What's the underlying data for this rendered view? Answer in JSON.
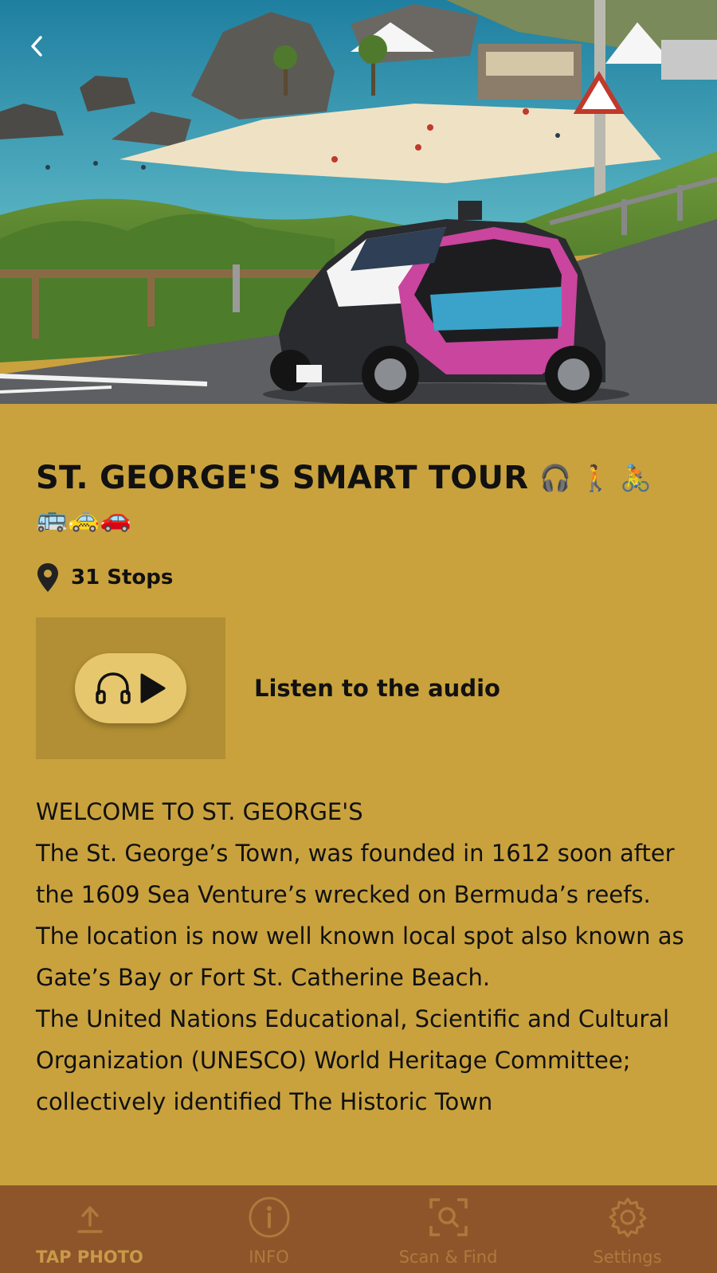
{
  "hero": {
    "back_icon": "chevron-left-icon"
  },
  "tour": {
    "title": "ST. GEORGE'S SMART TOUR",
    "title_emojis_line1": "🎧 🚶 🚴",
    "title_emojis_line2": "🚌🚕🚗",
    "stops_icon": "map-pin-icon",
    "stops_label": "31 Stops"
  },
  "audio": {
    "label": "Listen to the audio",
    "icons": [
      "headphones-icon",
      "play-icon"
    ]
  },
  "description": {
    "heading": "WELCOME TO ST. GEORGE'S",
    "paragraph1": "The St. George’s Town, was founded in 1612 soon after the 1609 Sea Venture’s wrecked on Bermuda’s reefs. The location is now well known local spot also known as Gate’s Bay or Fort St. Catherine Beach.",
    "paragraph2": "The United Nations Educational, Scientific and Cultural Organization (UNESCO) World Heritage Committee; collectively identified The Historic Town"
  },
  "tabbar": {
    "tabs": [
      {
        "label": "TAP PHOTO",
        "icon": "upload-icon",
        "active": true
      },
      {
        "label": "INFO",
        "icon": "info-icon",
        "active": false
      },
      {
        "label": "Scan & Find",
        "icon": "scan-icon",
        "active": false
      },
      {
        "label": "Settings",
        "icon": "gear-icon",
        "active": false
      }
    ]
  },
  "colors": {
    "background": "#c9a23e",
    "audio_box": "#b28f34",
    "audio_pill": "#e7c76e",
    "tabbar": "#8e552a",
    "tab_label": "#ad7a3d"
  }
}
